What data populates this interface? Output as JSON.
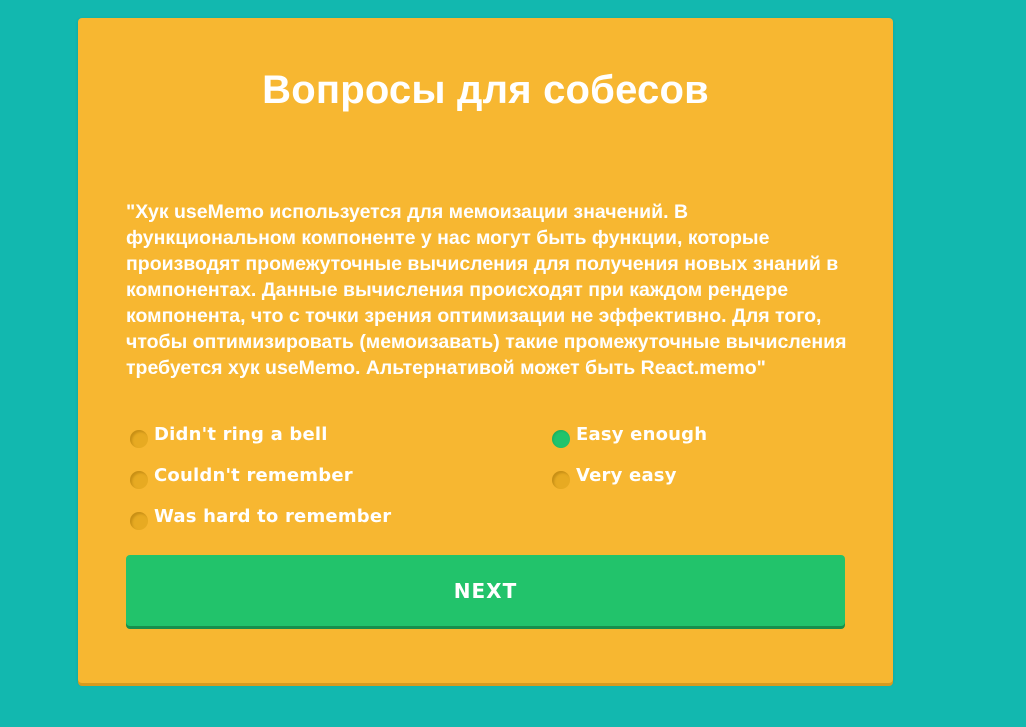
{
  "page": {
    "title": "Вопросы для собесов",
    "question": "\"Хук useMemo используется для мемоизации значений. В функциональном компоненте у нас могут быть функции, которые производят промежуточные вычисления для получения новых знаний в компонентах. Данные вычисления происходят при каждом рендере компонента, что с точки зрения оптимизации не эффективно. Для того, чтобы оптимизировать (мемоизавать) такие промежуточные вычисления требуется хук useMemo. Альтернативой может быть React.memo\""
  },
  "options": [
    {
      "label": "Didn't ring a bell",
      "checked": false
    },
    {
      "label": "Couldn't remember",
      "checked": false
    },
    {
      "label": "Was hard to remember",
      "checked": false
    },
    {
      "label": "Easy enough",
      "checked": true
    },
    {
      "label": "Very easy",
      "checked": false
    }
  ],
  "next_button": {
    "label": "NEXT"
  },
  "colors": {
    "background": "#12b8af",
    "card": "#f7b731",
    "accent": "#22c36b",
    "text": "#ffffff"
  },
  "icons": {
    "radio": "radio-button-icon"
  }
}
